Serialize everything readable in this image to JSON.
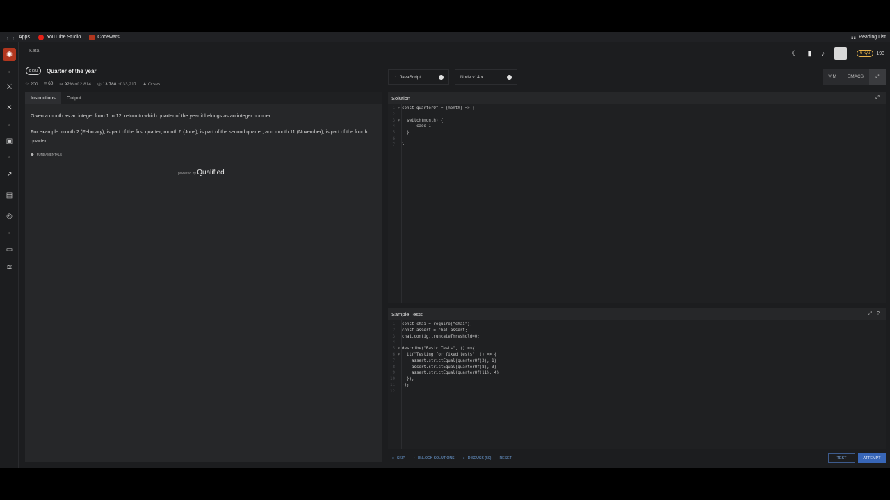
{
  "bookmarks": {
    "apps": "Apps",
    "youtube": "YouTube Studio",
    "codewars": "Codewars",
    "reading_list": "Reading List"
  },
  "header": {
    "section": "Kata",
    "rank_badge": "6 kyu",
    "honor": "193"
  },
  "kata": {
    "kyu": "8 kyu",
    "title": "Quarter of the year",
    "stats": {
      "stars": "200",
      "collections": "60",
      "satisfaction": "92%",
      "satisfaction_of": "of 2,814",
      "completed": "13,788",
      "completed_of": "of 33,217",
      "author": "Orses"
    }
  },
  "tabs": {
    "instructions": "Instructions",
    "output": "Output"
  },
  "instructions": {
    "p1": "Given a month as an integer from 1 to 12, return to which quarter of the year it belongs as an integer number.",
    "p2": "For example: month 2 (February), is part of the first quarter; month 6 (June), is part of the second quarter; and month 11 (November), is part of the fourth quarter.",
    "tag": "FUNDAMENTALS",
    "powered_prefix": "powered by",
    "powered_brand": "Qualified"
  },
  "controls": {
    "language": "JavaScript",
    "runtime": "Node v14.x",
    "vim": "VIM",
    "emacs": "EMACS"
  },
  "solution": {
    "title": "Solution",
    "lines": [
      "const quarterOf = (month) => {",
      "",
      "  switch(month) {",
      "      case 1:",
      "  }",
      "",
      "}"
    ]
  },
  "sample_tests": {
    "title": "Sample Tests",
    "lines": [
      "const chai = require(\"chai\");",
      "const assert = chai.assert;",
      "chai.config.truncateThreshold=0;",
      "",
      "describe(\"Basic Tests\", () =>{",
      "  it(\"Testing for fixed tests\", () => {",
      "    assert.strictEqual(quarterOf(3), 1)",
      "    assert.strictEqual(quarterOf(8), 3)",
      "    assert.strictEqual(quarterOf(11), 4)",
      "  });",
      "});",
      ""
    ]
  },
  "actions": {
    "skip": "SKIP",
    "unlock": "UNLOCK SOLUTIONS",
    "discuss": "DISCUSS (50)",
    "reset": "RESET",
    "test": "TEST",
    "attempt": "ATTEMPT"
  },
  "colors": {
    "brand": "#b1361e",
    "rank": "#e7b34a",
    "accent": "#3866b7"
  }
}
